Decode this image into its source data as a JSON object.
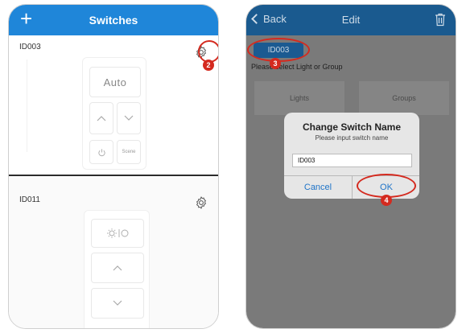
{
  "left": {
    "title": "Switches",
    "add_label": "+",
    "card1": {
      "id": "ID003",
      "auto_label": "Auto",
      "scene_label": "Scene"
    },
    "card2": {
      "id": "ID011"
    },
    "marker": "2"
  },
  "right": {
    "back_label": "Back",
    "title": "Edit",
    "id_pill": "ID003",
    "select_prompt": "Please select Light or Group",
    "tabs": [
      "Lights",
      "Groups"
    ],
    "dialog": {
      "title": "Change Switch Name",
      "subtitle": "Please input switch name",
      "input_value": "ID003",
      "cancel_label": "Cancel",
      "ok_label": "OK"
    },
    "markers": [
      "3",
      "4"
    ]
  },
  "colors": {
    "accent": "#1f86d9",
    "marker_red": "#d42a1f",
    "link_blue": "#1f74c8"
  },
  "icons": [
    "plus-icon",
    "gear-icon",
    "chevron-up-icon",
    "chevron-down-icon",
    "power-icon",
    "bulb-icon",
    "back-chevron-icon",
    "trash-icon"
  ]
}
